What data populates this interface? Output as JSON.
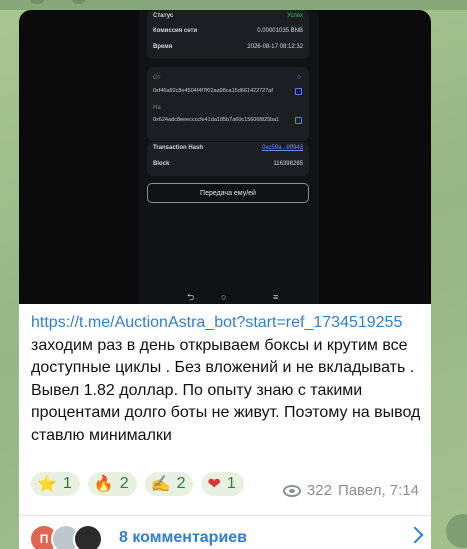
{
  "phone": {
    "status_label": "Статус",
    "status_value": "Успех",
    "fee_label": "Комиссия сети",
    "fee_value": "0.00001035 BNB",
    "time_label": "Время",
    "time_value": "2026-08-17 08:12:32",
    "from_label": "От",
    "from_value": "0xf46a92c8e4504f4f7f02aa98ca15d661422727af",
    "to_label": "На",
    "to_value": "0x624adc8eeeccccfe41da185b7a60c15606f825ba1",
    "hash_label": "Transaction Hash",
    "hash_value": "0xc59a...6ff943",
    "block_label": "Block",
    "block_value": "116398265",
    "send_button": "Передача ему/ей"
  },
  "message": {
    "link": "https://t.me/AuctionAstra_bot?start=ref_1734519255",
    "text": " заходим раз в день открываем боксы и крутим все доступные циклы . Без вложений и не вкладывать . Вывел 1.82 доллар. По опыту знаю с такими процентами долго боты не живут. Поэтому на вывод ставлю минималки"
  },
  "reactions": [
    {
      "emoji": "⭐",
      "count": "1"
    },
    {
      "emoji": "🔥",
      "count": "2"
    },
    {
      "emoji": "✍",
      "count": "2"
    },
    {
      "emoji": "❤",
      "count": "1"
    }
  ],
  "meta": {
    "views": "322",
    "author_time": "Павел, 7:14"
  },
  "comments": {
    "avatar_letter": "П",
    "label": "8 комментариев"
  },
  "colors": {
    "link": "#2f7fcf",
    "success": "#29c26a",
    "background": "#9fbf8c"
  }
}
